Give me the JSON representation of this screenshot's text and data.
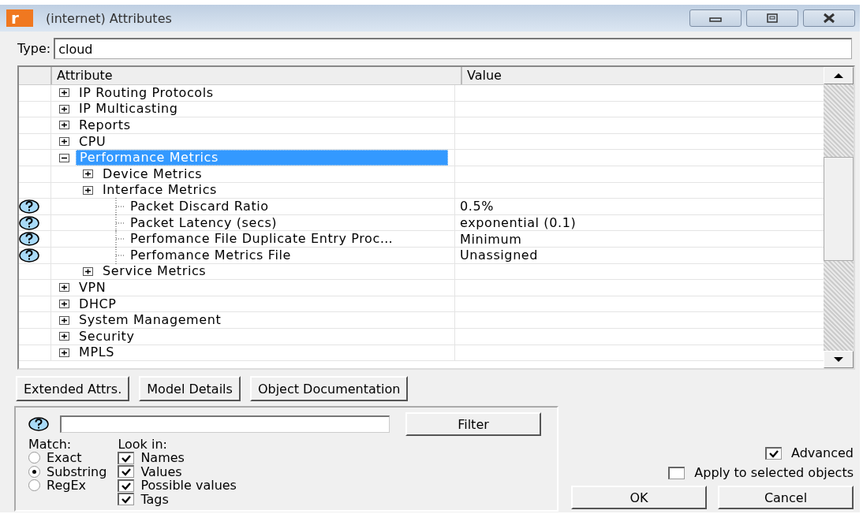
{
  "window": {
    "icon_letter": "r",
    "title": "(internet) Attributes"
  },
  "type_field": {
    "label": "Type:",
    "value": "cloud"
  },
  "table": {
    "columns": [
      "Attribute",
      "Value"
    ],
    "rows": [
      {
        "kind": "group",
        "name": "IP Routing Protocols",
        "expanded": false,
        "selected": false
      },
      {
        "kind": "group",
        "name": "IP Multicasting",
        "expanded": false,
        "selected": false
      },
      {
        "kind": "group",
        "name": "Reports",
        "expanded": false,
        "selected": false
      },
      {
        "kind": "group",
        "name": "CPU",
        "expanded": false,
        "selected": false
      },
      {
        "kind": "group",
        "name": "Performance Metrics",
        "expanded": true,
        "selected": true,
        "children": [
          {
            "kind": "group",
            "name": "Device Metrics",
            "expanded": false,
            "selected": false
          },
          {
            "kind": "group",
            "name": "Interface Metrics",
            "expanded": false,
            "selected": false
          },
          {
            "kind": "attribute",
            "name": "Packet Discard Ratio",
            "value": "0.5%",
            "selected": false
          },
          {
            "kind": "attribute",
            "name": "Packet Latency (secs)",
            "value": "exponential (0.1)",
            "selected": false
          },
          {
            "kind": "attribute",
            "name": "Perfomance File Duplicate Entry Proc…",
            "value": "Minimum",
            "selected": false
          },
          {
            "kind": "attribute",
            "name": "Perfomance Metrics File",
            "value": "Unassigned",
            "selected": false
          },
          {
            "kind": "group",
            "name": "Service Metrics",
            "expanded": false,
            "selected": false
          }
        ]
      },
      {
        "kind": "group",
        "name": "VPN",
        "expanded": false,
        "selected": false
      },
      {
        "kind": "group",
        "name": "DHCP",
        "expanded": false,
        "selected": false
      },
      {
        "kind": "group",
        "name": "System Management",
        "expanded": false,
        "selected": false
      },
      {
        "kind": "group",
        "name": "Security",
        "expanded": false,
        "selected": false
      },
      {
        "kind": "group",
        "name": "MPLS",
        "expanded": false,
        "selected": false
      }
    ]
  },
  "buttons": [
    "Extended Attrs.",
    "Model Details",
    "Object Documentation"
  ],
  "filter": {
    "button": "Filter",
    "match_label": "Match:",
    "match_options": [
      {
        "label": "Exact",
        "selected": false
      },
      {
        "label": "Substring",
        "selected": true
      },
      {
        "label": "RegEx",
        "selected": false
      }
    ],
    "look_in_label": "Look in:",
    "look_in": [
      {
        "label": "Names",
        "checked": true
      },
      {
        "label": "Values",
        "checked": true
      },
      {
        "label": "Possible values",
        "checked": true
      },
      {
        "label": "Tags",
        "checked": true
      }
    ]
  },
  "options": [
    {
      "label": "Advanced",
      "checked": true
    },
    {
      "label": "Apply to selected objects",
      "checked": false
    }
  ],
  "dialog_buttons": [
    "OK",
    "Cancel"
  ]
}
